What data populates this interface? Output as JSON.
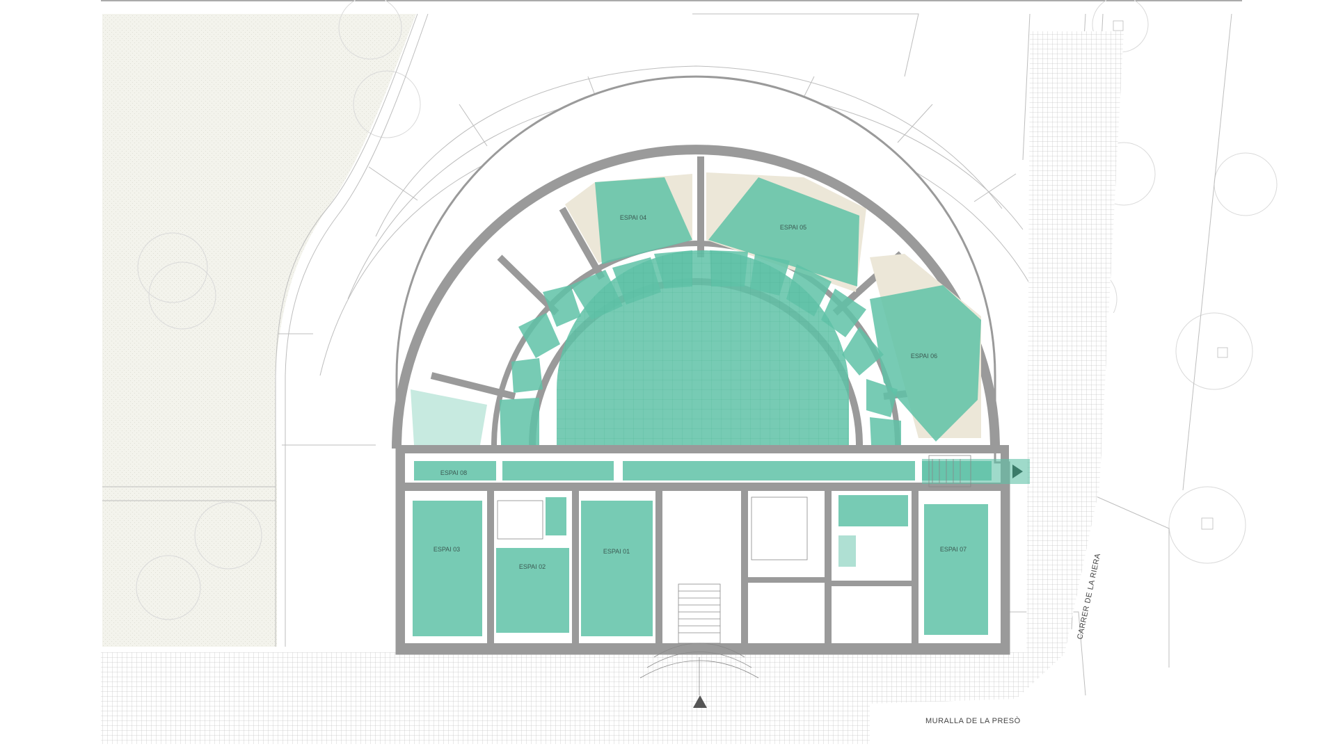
{
  "plan": {
    "spaces": [
      {
        "id": "espai-01",
        "label": "ESPAI 01"
      },
      {
        "id": "espai-02",
        "label": "ESPAI 02"
      },
      {
        "id": "espai-03",
        "label": "ESPAI 03"
      },
      {
        "id": "espai-04",
        "label": "ESPAI 04"
      },
      {
        "id": "espai-05",
        "label": "ESPAI 05"
      },
      {
        "id": "espai-06",
        "label": "ESPAI 06"
      },
      {
        "id": "espai-07",
        "label": "ESPAI 07"
      },
      {
        "id": "espai-08",
        "label": "ESPAI 08"
      }
    ],
    "streets": {
      "riera": "CARRER DE LA RIERA",
      "muralla": "MURALLA DE LA PRESÒ"
    },
    "colors": {
      "space_fill": "#5fc2a7",
      "wall": "#9a9a9a",
      "paving_line": "#c9c9c9",
      "garden": "#f1f1ea",
      "sand": "#ece7d8",
      "outline": "#b5b5b5"
    }
  }
}
